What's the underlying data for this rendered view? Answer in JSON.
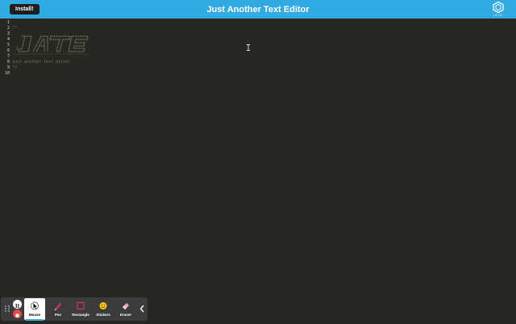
{
  "header": {
    "install_label": "Install!",
    "title": "Just Another Text Editor",
    "logo_text": "JATE",
    "background": "#31a9e1"
  },
  "editor": {
    "background": "#272822",
    "line_numbers": [
      "1",
      "2",
      "3",
      "4",
      "5",
      "6",
      "7",
      "8",
      "9",
      "10"
    ],
    "lines": [
      "",
      "/*",
      "",
      "",
      "",
      "",
      "",
      "just another text editor",
      "*/",
      ""
    ],
    "ascii_art_text": "JATE"
  },
  "toolbar": {
    "tools": [
      {
        "label": "Mouse",
        "icon": "mouse-icon",
        "active": true
      },
      {
        "label": "Pen",
        "icon": "pen-icon",
        "active": false
      },
      {
        "label": "Rectangle",
        "icon": "rectangle-icon",
        "active": false
      },
      {
        "label": "Stickers",
        "icon": "sticker-icon",
        "active": false
      },
      {
        "label": "Eraser",
        "icon": "eraser-icon",
        "active": false
      }
    ]
  }
}
